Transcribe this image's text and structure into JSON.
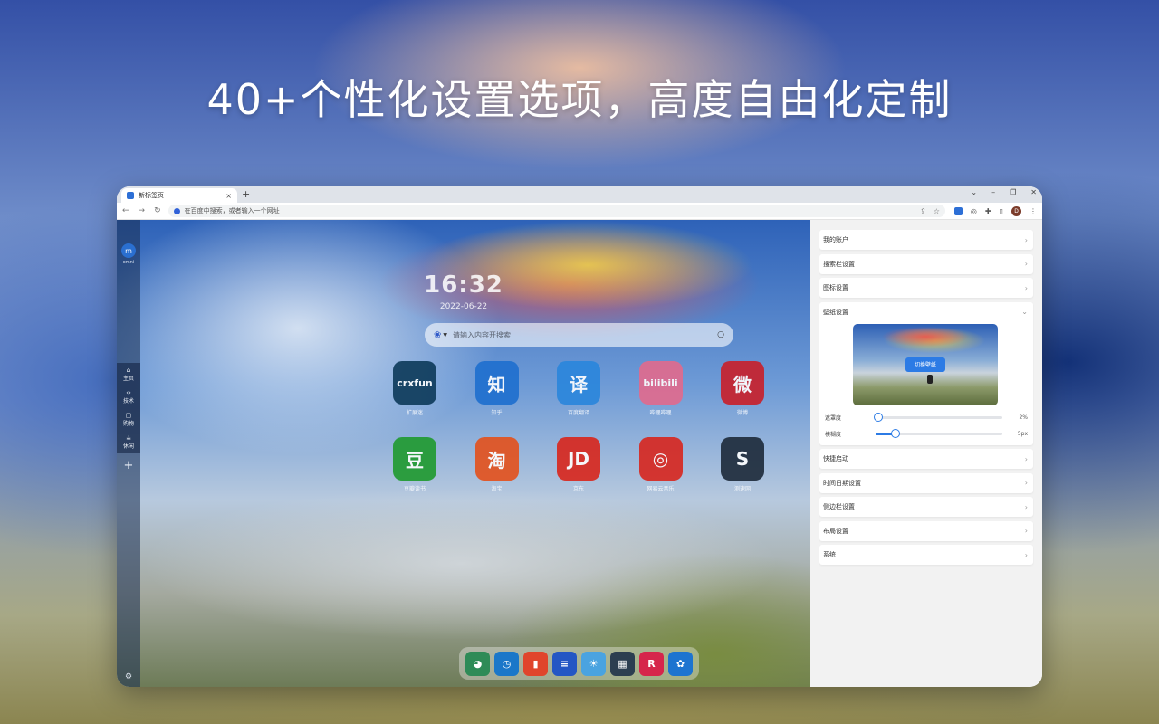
{
  "headline": "40+个性化设置选项，高度自由化定制",
  "browser": {
    "tab_title": "新标签页",
    "tab_close": "×",
    "new_tab": "+",
    "address_placeholder": "在百度中搜索，或者输入一个网址",
    "avatar_letter": "D"
  },
  "sidebar": {
    "logo_text": "omni",
    "items": [
      {
        "label": "主页",
        "icon": "home-icon"
      },
      {
        "label": "技术",
        "icon": "code-icon"
      },
      {
        "label": "购物",
        "icon": "bag-icon"
      },
      {
        "label": "休闲",
        "icon": "coffee-icon"
      }
    ],
    "add": "+"
  },
  "clock": {
    "time": "16:32",
    "date": "2022-06-22"
  },
  "search": {
    "placeholder": "请输入内容开搜索"
  },
  "apps": [
    {
      "label": "扩展迷",
      "text": "crxfun",
      "color": "#0d3a5a"
    },
    {
      "label": "知乎",
      "text": "知",
      "color": "#1e6fcf"
    },
    {
      "label": "百度翻译",
      "text": "译",
      "color": "#2a86dc"
    },
    {
      "label": "哔哩哔哩",
      "text": "bilibili",
      "color": "#e26a8d"
    },
    {
      "label": "微博",
      "text": "微",
      "color": "#c91f2a"
    },
    {
      "label": "豆瓣读书",
      "text": "豆",
      "color": "#1f9a2f"
    },
    {
      "label": "淘宝",
      "text": "淘",
      "color": "#e4511c"
    },
    {
      "label": "京东",
      "text": "JD",
      "color": "#d9261c"
    },
    {
      "label": "网易云音乐",
      "text": "◎",
      "color": "#d8261e"
    },
    {
      "label": "测速网",
      "text": "S",
      "color": "#1d2a3a"
    }
  ],
  "dock": [
    {
      "icon": "chrome-icon",
      "text": "◕",
      "color": "#2e8b57"
    },
    {
      "icon": "clock-icon",
      "text": "◷",
      "color": "#1b77c9"
    },
    {
      "icon": "bookmark-icon",
      "text": "▮",
      "color": "#e0452c"
    },
    {
      "icon": "list-icon",
      "text": "≡",
      "color": "#2456c4"
    },
    {
      "icon": "weather-icon",
      "text": "☀",
      "color": "#4aa3e0"
    },
    {
      "icon": "calendar-icon",
      "text": "▦",
      "color": "#2c3e50"
    },
    {
      "icon": "r-icon",
      "text": "R",
      "color": "#d6264b"
    },
    {
      "icon": "settings-icon",
      "text": "✿",
      "color": "#1d74d0"
    }
  ],
  "panel": {
    "rows_top": [
      "我的账户",
      "搜索栏设置",
      "图标设置"
    ],
    "wallpaper_title": "壁纸设置",
    "wallpaper_button": "切换壁纸",
    "sliders": [
      {
        "label": "遮罩度",
        "value_text": "2%",
        "value": 0.02
      },
      {
        "label": "模糊度",
        "value_text": "5px",
        "value": 0.16
      }
    ],
    "rows_bottom": [
      "快捷启动",
      "时间日期设置",
      "侧边栏设置",
      "布局设置",
      "系统"
    ],
    "chevron": "›",
    "chevron_open": "⌄"
  }
}
